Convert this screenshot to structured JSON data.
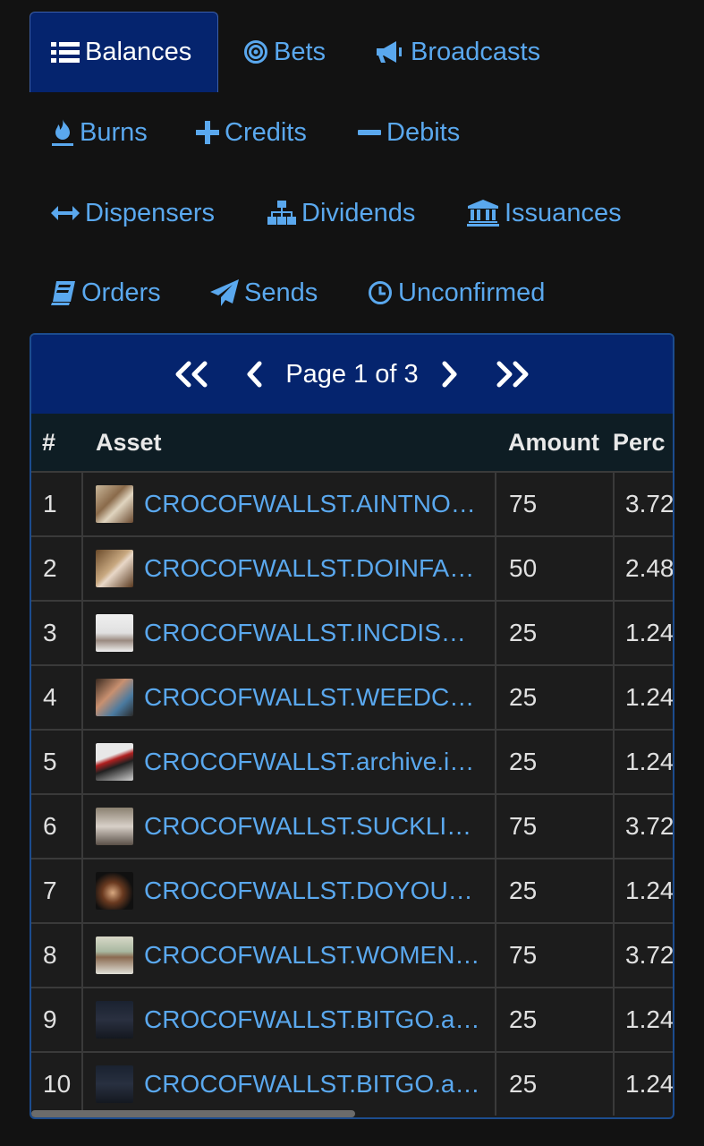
{
  "tabs": [
    {
      "label": "Balances",
      "icon": "list-icon",
      "active": true
    },
    {
      "label": "Bets",
      "icon": "bullseye-icon"
    },
    {
      "label": "Broadcasts",
      "icon": "bullhorn-icon"
    },
    {
      "label": "Burns",
      "icon": "fire-icon"
    },
    {
      "label": "Credits",
      "icon": "plus-icon"
    },
    {
      "label": "Debits",
      "icon": "minus-icon"
    },
    {
      "label": "Dispensers",
      "icon": "arrows-horizontal-icon"
    },
    {
      "label": "Dividends",
      "icon": "sitemap-icon"
    },
    {
      "label": "Issuances",
      "icon": "bank-icon"
    },
    {
      "label": "Orders",
      "icon": "book-icon"
    },
    {
      "label": "Sends",
      "icon": "paper-plane-icon"
    },
    {
      "label": "Unconfirmed",
      "icon": "clock-icon"
    }
  ],
  "pager": {
    "label": "Page 1 of 3"
  },
  "table": {
    "headers": {
      "num": "#",
      "asset": "Asset",
      "amount": "Amount",
      "percent": "Perc"
    },
    "rows": [
      {
        "num": "1",
        "asset": "CROCOFWALLST.AINTNO…",
        "amount": "75",
        "percent": "3.72"
      },
      {
        "num": "2",
        "asset": "CROCOFWALLST.DOINFA…",
        "amount": "50",
        "percent": "2.48"
      },
      {
        "num": "3",
        "asset": "CROCOFWALLST.INCDISM…",
        "amount": "25",
        "percent": "1.24"
      },
      {
        "num": "4",
        "asset": "CROCOFWALLST.WEEDCO…",
        "amount": "25",
        "percent": "1.24"
      },
      {
        "num": "5",
        "asset": "CROCOFWALLST.archive.i…",
        "amount": "25",
        "percent": "1.24"
      },
      {
        "num": "6",
        "asset": "CROCOFWALLST.SUCKLIK…",
        "amount": "75",
        "percent": "3.72"
      },
      {
        "num": "7",
        "asset": "CROCOFWALLST.DOYOUR…",
        "amount": "25",
        "percent": "1.24"
      },
      {
        "num": "8",
        "asset": "CROCOFWALLST.WOMEN…",
        "amount": "75",
        "percent": "3.72"
      },
      {
        "num": "9",
        "asset": "CROCOFWALLST.BITGO.ar…",
        "amount": "25",
        "percent": "1.24"
      },
      {
        "num": "10",
        "asset": "CROCOFWALLST.BITGO.ar…",
        "amount": "25",
        "percent": "1.24"
      }
    ]
  },
  "colors": {
    "accent": "#5aa8ee",
    "header_bg": "#05246e",
    "table_head_bg": "#0e1d24",
    "page_bg": "#121212"
  }
}
